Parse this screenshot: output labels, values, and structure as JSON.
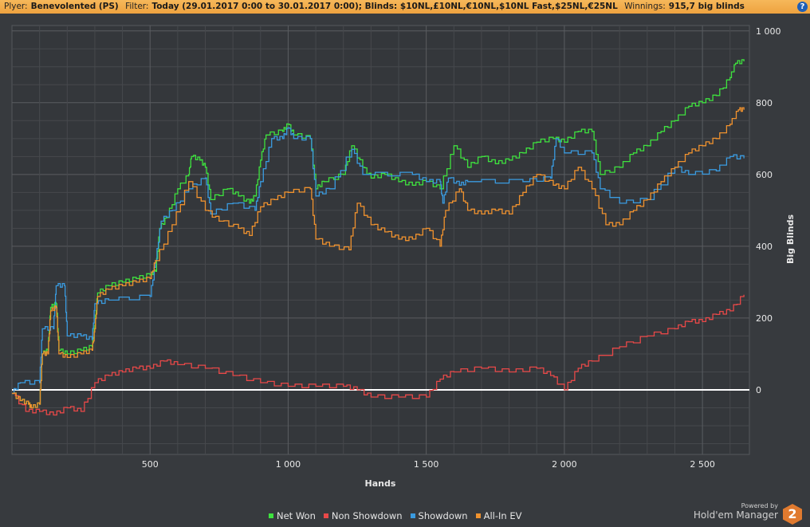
{
  "header": {
    "player_label": "Plyer:",
    "player": "Benevolented (PS)",
    "filter_label": "Filter:",
    "filter": "Today (29.01.2017 0:00 to 30.01.2017 0:00); Blinds: $10NL,£10NL,€10NL,$10NL Fast,$25NL,€25NL",
    "winnings_label": "Winnings:",
    "winnings": "915,7 big blinds",
    "help": "?"
  },
  "branding": {
    "powered": "Powered by",
    "name": "Hold'em Manager",
    "logo": "2"
  },
  "chart_data": {
    "type": "line",
    "xlabel": "Hands",
    "ylabel": "Big Blinds",
    "xlim": [
      0,
      2670
    ],
    "ylim": [
      -180,
      1015
    ],
    "xticks": [
      500,
      1000,
      1500,
      2000,
      2500
    ],
    "xtick_labels": [
      "500",
      "1 000",
      "1 500",
      "2 000",
      "2 500"
    ],
    "yticks": [
      0,
      200,
      400,
      600,
      800,
      1000
    ],
    "ytick_labels": [
      "0",
      "200",
      "400",
      "600",
      "800",
      "1 000"
    ],
    "grid": true,
    "legend": "bottom",
    "series": [
      {
        "name": "Net Won",
        "color": "#3ee23e",
        "points": [
          [
            0,
            -10
          ],
          [
            30,
            -30
          ],
          [
            60,
            -40
          ],
          [
            70,
            -50
          ],
          [
            100,
            -40
          ],
          [
            110,
            100
          ],
          [
            130,
            110
          ],
          [
            140,
            230
          ],
          [
            160,
            240
          ],
          [
            170,
            110
          ],
          [
            200,
            100
          ],
          [
            250,
            110
          ],
          [
            290,
            120
          ],
          [
            300,
            180
          ],
          [
            310,
            270
          ],
          [
            350,
            290
          ],
          [
            400,
            300
          ],
          [
            450,
            310
          ],
          [
            500,
            320
          ],
          [
            520,
            330
          ],
          [
            535,
            450
          ],
          [
            560,
            480
          ],
          [
            600,
            560
          ],
          [
            640,
            600
          ],
          [
            650,
            650
          ],
          [
            680,
            640
          ],
          [
            700,
            620
          ],
          [
            720,
            530
          ],
          [
            780,
            560
          ],
          [
            820,
            540
          ],
          [
            860,
            520
          ],
          [
            880,
            540
          ],
          [
            900,
            640
          ],
          [
            920,
            710
          ],
          [
            980,
            720
          ],
          [
            1000,
            740
          ],
          [
            1020,
            710
          ],
          [
            1080,
            700
          ],
          [
            1100,
            560
          ],
          [
            1130,
            580
          ],
          [
            1200,
            600
          ],
          [
            1230,
            680
          ],
          [
            1270,
            620
          ],
          [
            1300,
            590
          ],
          [
            1350,
            600
          ],
          [
            1400,
            580
          ],
          [
            1450,
            570
          ],
          [
            1500,
            580
          ],
          [
            1550,
            560
          ],
          [
            1600,
            680
          ],
          [
            1650,
            620
          ],
          [
            1700,
            650
          ],
          [
            1750,
            630
          ],
          [
            1800,
            640
          ],
          [
            1850,
            660
          ],
          [
            1900,
            690
          ],
          [
            1960,
            700
          ],
          [
            2000,
            690
          ],
          [
            2050,
            720
          ],
          [
            2100,
            720
          ],
          [
            2130,
            600
          ],
          [
            2200,
            620
          ],
          [
            2250,
            660
          ],
          [
            2300,
            680
          ],
          [
            2350,
            720
          ],
          [
            2400,
            750
          ],
          [
            2450,
            790
          ],
          [
            2500,
            800
          ],
          [
            2550,
            820
          ],
          [
            2600,
            870
          ],
          [
            2620,
            910
          ],
          [
            2650,
            915
          ]
        ]
      },
      {
        "name": "Non Showdown",
        "color": "#e84848",
        "points": [
          [
            0,
            -10
          ],
          [
            50,
            -60
          ],
          [
            100,
            -60
          ],
          [
            150,
            -70
          ],
          [
            200,
            -50
          ],
          [
            250,
            -60
          ],
          [
            300,
            20
          ],
          [
            350,
            40
          ],
          [
            400,
            50
          ],
          [
            450,
            60
          ],
          [
            500,
            60
          ],
          [
            550,
            80
          ],
          [
            600,
            70
          ],
          [
            700,
            60
          ],
          [
            800,
            40
          ],
          [
            900,
            20
          ],
          [
            1000,
            10
          ],
          [
            1100,
            10
          ],
          [
            1200,
            10
          ],
          [
            1250,
            0
          ],
          [
            1300,
            -20
          ],
          [
            1400,
            -20
          ],
          [
            1500,
            -20
          ],
          [
            1550,
            30
          ],
          [
            1600,
            50
          ],
          [
            1700,
            60
          ],
          [
            1800,
            50
          ],
          [
            1900,
            60
          ],
          [
            1950,
            40
          ],
          [
            2000,
            0
          ],
          [
            2050,
            60
          ],
          [
            2100,
            80
          ],
          [
            2200,
            120
          ],
          [
            2300,
            150
          ],
          [
            2400,
            170
          ],
          [
            2450,
            190
          ],
          [
            2500,
            190
          ],
          [
            2550,
            210
          ],
          [
            2600,
            220
          ],
          [
            2650,
            265
          ]
        ]
      },
      {
        "name": "Showdown",
        "color": "#3a9be0",
        "points": [
          [
            0,
            -10
          ],
          [
            30,
            20
          ],
          [
            100,
            20
          ],
          [
            110,
            170
          ],
          [
            150,
            170
          ],
          [
            160,
            290
          ],
          [
            190,
            290
          ],
          [
            200,
            150
          ],
          [
            250,
            150
          ],
          [
            290,
            140
          ],
          [
            300,
            240
          ],
          [
            350,
            250
          ],
          [
            500,
            260
          ],
          [
            520,
            360
          ],
          [
            540,
            470
          ],
          [
            580,
            500
          ],
          [
            640,
            560
          ],
          [
            700,
            590
          ],
          [
            720,
            490
          ],
          [
            800,
            520
          ],
          [
            880,
            500
          ],
          [
            900,
            580
          ],
          [
            940,
            700
          ],
          [
            980,
            700
          ],
          [
            1000,
            730
          ],
          [
            1020,
            700
          ],
          [
            1080,
            700
          ],
          [
            1100,
            540
          ],
          [
            1150,
            560
          ],
          [
            1230,
            670
          ],
          [
            1270,
            600
          ],
          [
            1450,
            600
          ],
          [
            1500,
            580
          ],
          [
            1550,
            580
          ],
          [
            1560,
            520
          ],
          [
            1580,
            590
          ],
          [
            1620,
            570
          ],
          [
            1650,
            580
          ],
          [
            1850,
            580
          ],
          [
            1950,
            590
          ],
          [
            1970,
            700
          ],
          [
            2000,
            660
          ],
          [
            2100,
            660
          ],
          [
            2130,
            560
          ],
          [
            2200,
            520
          ],
          [
            2300,
            530
          ],
          [
            2400,
            620
          ],
          [
            2450,
            600
          ],
          [
            2550,
            610
          ],
          [
            2600,
            650
          ],
          [
            2650,
            645
          ]
        ]
      },
      {
        "name": "All-In EV",
        "color": "#f0922e",
        "points": [
          [
            0,
            -10
          ],
          [
            30,
            -30
          ],
          [
            60,
            -40
          ],
          [
            70,
            -50
          ],
          [
            100,
            -40
          ],
          [
            110,
            100
          ],
          [
            130,
            100
          ],
          [
            140,
            220
          ],
          [
            160,
            230
          ],
          [
            170,
            100
          ],
          [
            200,
            90
          ],
          [
            250,
            100
          ],
          [
            290,
            110
          ],
          [
            300,
            170
          ],
          [
            310,
            260
          ],
          [
            350,
            280
          ],
          [
            400,
            290
          ],
          [
            450,
            300
          ],
          [
            500,
            310
          ],
          [
            520,
            360
          ],
          [
            580,
            460
          ],
          [
            640,
            580
          ],
          [
            700,
            500
          ],
          [
            750,
            470
          ],
          [
            820,
            450
          ],
          [
            860,
            430
          ],
          [
            900,
            510
          ],
          [
            950,
            530
          ],
          [
            1000,
            550
          ],
          [
            1080,
            560
          ],
          [
            1100,
            420
          ],
          [
            1150,
            400
          ],
          [
            1220,
            390
          ],
          [
            1250,
            520
          ],
          [
            1300,
            460
          ],
          [
            1350,
            440
          ],
          [
            1400,
            420
          ],
          [
            1450,
            420
          ],
          [
            1500,
            450
          ],
          [
            1550,
            400
          ],
          [
            1570,
            500
          ],
          [
            1620,
            560
          ],
          [
            1650,
            500
          ],
          [
            1700,
            490
          ],
          [
            1750,
            500
          ],
          [
            1800,
            490
          ],
          [
            1850,
            550
          ],
          [
            1900,
            600
          ],
          [
            1960,
            570
          ],
          [
            2000,
            560
          ],
          [
            2050,
            620
          ],
          [
            2100,
            560
          ],
          [
            2150,
            460
          ],
          [
            2200,
            460
          ],
          [
            2250,
            500
          ],
          [
            2300,
            530
          ],
          [
            2350,
            580
          ],
          [
            2400,
            620
          ],
          [
            2450,
            660
          ],
          [
            2500,
            680
          ],
          [
            2550,
            700
          ],
          [
            2600,
            740
          ],
          [
            2630,
            780
          ],
          [
            2650,
            780
          ]
        ]
      }
    ]
  }
}
